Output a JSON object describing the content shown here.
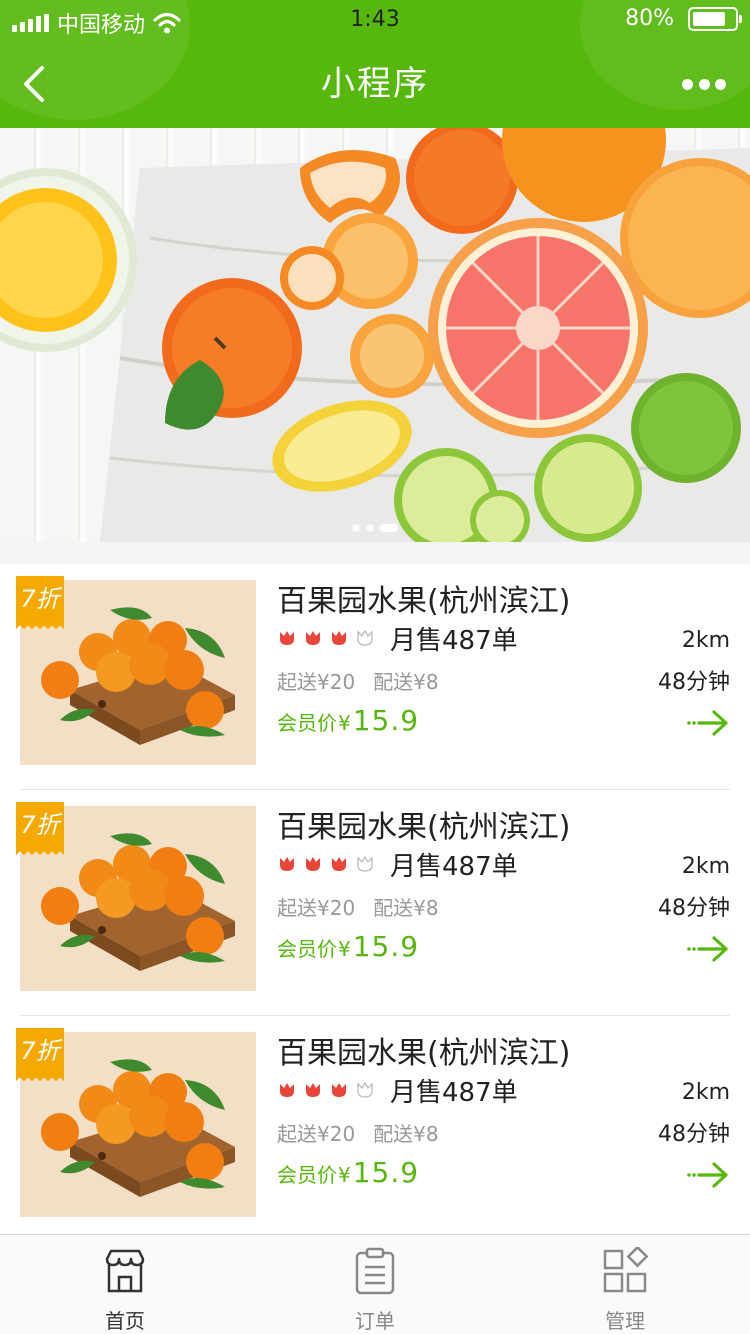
{
  "status_bar": {
    "carrier": "中国移动",
    "time": "1:43",
    "battery": "80%"
  },
  "header": {
    "title": "小程序"
  },
  "banner": {
    "slide_count": 3,
    "active_index": 2
  },
  "shops": [
    {
      "discount": "7折",
      "name": "百果园水果(杭州滨江)",
      "rating": 3,
      "rating_max": 4,
      "monthly_sales": "月售487单",
      "min_order": "起送¥20",
      "delivery_fee": "配送¥8",
      "distance": "2km",
      "delivery_time": "48分钟",
      "member_price_label": "会员价",
      "currency": "¥",
      "member_price": "15.9"
    },
    {
      "discount": "7折",
      "name": "百果园水果(杭州滨江)",
      "rating": 3,
      "rating_max": 4,
      "monthly_sales": "月售487单",
      "min_order": "起送¥20",
      "delivery_fee": "配送¥8",
      "distance": "2km",
      "delivery_time": "48分钟",
      "member_price_label": "会员价",
      "currency": "¥",
      "member_price": "15.9"
    },
    {
      "discount": "7折",
      "name": "百果园水果(杭州滨江)",
      "rating": 3,
      "rating_max": 4,
      "monthly_sales": "月售487单",
      "min_order": "起送¥20",
      "delivery_fee": "配送¥8",
      "distance": "2km",
      "delivery_time": "48分钟",
      "member_price_label": "会员价",
      "currency": "¥",
      "member_price": "15.9"
    }
  ],
  "tabbar": {
    "items": [
      {
        "label": "首页",
        "icon": "store-icon",
        "active": true
      },
      {
        "label": "订单",
        "icon": "clipboard-icon",
        "active": false
      },
      {
        "label": "管理",
        "icon": "grid-icon",
        "active": false
      }
    ]
  },
  "colors": {
    "brand_green": "#56b80c",
    "badge_orange": "#f5a800",
    "star_red": "#e8463a"
  }
}
